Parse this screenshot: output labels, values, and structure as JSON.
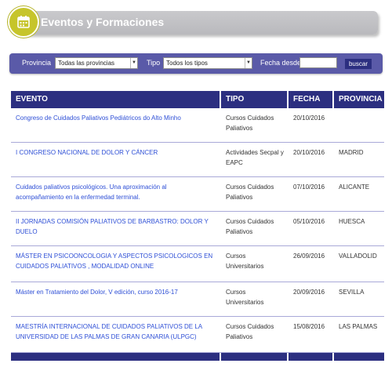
{
  "header": {
    "title": "Eventos y Formaciones",
    "icon": "calendar-icon",
    "accent": "#c6c52b"
  },
  "filters": {
    "provincia_label": "Provincia",
    "provincia_value": "Todas las provincias",
    "tipo_label": "Tipo",
    "tipo_value": "Todos los tipos",
    "fecha_label": "Fecha desde",
    "fecha_value": "",
    "button_label": "buscar",
    "bar_color": "#5a5aa8"
  },
  "table": {
    "columns": [
      "EVENTO",
      "TIPO",
      "FECHA",
      "PROVINCIA"
    ],
    "header_color": "#2c2f80",
    "link_color": "#2e4fd6",
    "rows": [
      {
        "evento": "Congreso de Cuidados Paliativos Pediátricos do Alto Minho",
        "tipo": "Cursos Cuidados Paliativos",
        "fecha": "20/10/2016",
        "provincia": ""
      },
      {
        "evento": "I CONGRESO NACIONAL DE DOLOR Y CÁNCER",
        "tipo": "Actividades Secpal y EAPC",
        "fecha": "20/10/2016",
        "provincia": "MADRID"
      },
      {
        "evento": "Cuidados paliativos psicológicos. Una aproximación al acompañamiento en la enfermedad terminal.",
        "tipo": "Cursos Cuidados Paliativos",
        "fecha": "07/10/2016",
        "provincia": "ALICANTE"
      },
      {
        "evento": "II JORNADAS COMISIÓN PALIATIVOS DE BARBASTRO: DOLOR Y DUELO",
        "tipo": "Cursos Cuidados Paliativos",
        "fecha": "05/10/2016",
        "provincia": "HUESCA"
      },
      {
        "evento": "MÁSTER EN PSICOONCOLOGIA Y ASPECTOS PSICOLOGICOS EN CUIDADOS PALIATIVOS , MODALIDAD ONLINE",
        "tipo": "Cursos Universitarios",
        "fecha": "26/09/2016",
        "provincia": "VALLADOLID"
      },
      {
        "evento": "Máster en Tratamiento del Dolor, V edición, curso 2016-17",
        "tipo": "Cursos Universitarios",
        "fecha": "20/09/2016",
        "provincia": "SEVILLA"
      },
      {
        "evento": "MAESTRÍA INTERNACIONAL DE CUIDADOS PALIATIVOS DE LA UNIVERSIDAD DE LAS PALMAS DE GRAN CANARIA (ULPGC)",
        "tipo": "Cursos Cuidados Paliativos",
        "fecha": "15/08/2016",
        "provincia": "LAS PALMAS"
      }
    ]
  }
}
